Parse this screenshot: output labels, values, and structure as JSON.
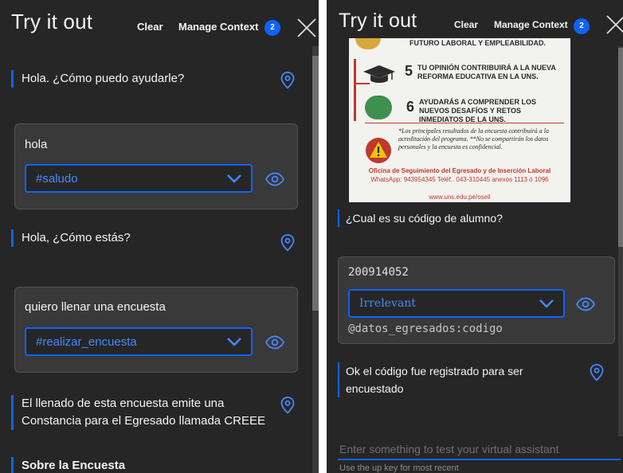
{
  "colors": {
    "accent": "#0f62fe",
    "panel_bg": "#262626",
    "card_bg": "#393939",
    "intent_text": "#4589ff"
  },
  "header": {
    "title": "Try it out",
    "clear_label": "Clear",
    "manage_context_label": "Manage Context",
    "context_count": "2"
  },
  "left_panel": {
    "messages": [
      {
        "type": "bot",
        "text": "Hola. ¿Cómo puedo ayudarle?"
      },
      {
        "type": "user",
        "text": "hola",
        "intent": "#saludo"
      },
      {
        "type": "bot",
        "text": "Hola, ¿Cómo estás?"
      },
      {
        "type": "user",
        "text": "quiero llenar una encuesta",
        "intent": "#realizar_encuesta"
      },
      {
        "type": "bot",
        "text": "El llenado de esta encuesta emite una Constancia para el Egresado llamada CREEE"
      },
      {
        "type": "bot",
        "text": "Sobre la Encuesta"
      }
    ]
  },
  "right_panel": {
    "poster": {
      "partial_line": "FUTURO LABORAL Y EMPLEABILIDAD.",
      "items": [
        {
          "number": "5",
          "text": "TU OPINIÓN CONTRIBUIRÁ A LA NUEVA REFORMA EDUCATIVA EN LA UNS."
        },
        {
          "number": "6",
          "text": "AYUDARÁS A COMPRENDER LOS NUEVOS DESAFÍOS Y RETOS INMEDIATOS DE LA UNS."
        }
      ],
      "note": "*Los principales resultados de la encuesta contribuirá a la acreditación del programa. **No se compartirán los datos personales y la encuesta es confidencial.",
      "office": "Oficina de Seguimiento del Egresado y de Inserción Laboral",
      "contact": "WhatsApp: 943954345 Teléf.. 043-310445 anexos 1113 ó 1096",
      "url": "www.uns.edu.pe/oseil"
    },
    "messages": [
      {
        "type": "bot",
        "text": "¿Cual es su código de alumno?"
      },
      {
        "type": "user",
        "text": "200914052",
        "intent": "Irrelevant",
        "entity": "@datos_egresados:codigo"
      },
      {
        "type": "bot",
        "text": "Ok el código fue registrado para ser encuestado"
      }
    ],
    "input": {
      "placeholder": "Enter something to test your virtual assistant",
      "hint": "Use the up key for most recent"
    }
  }
}
